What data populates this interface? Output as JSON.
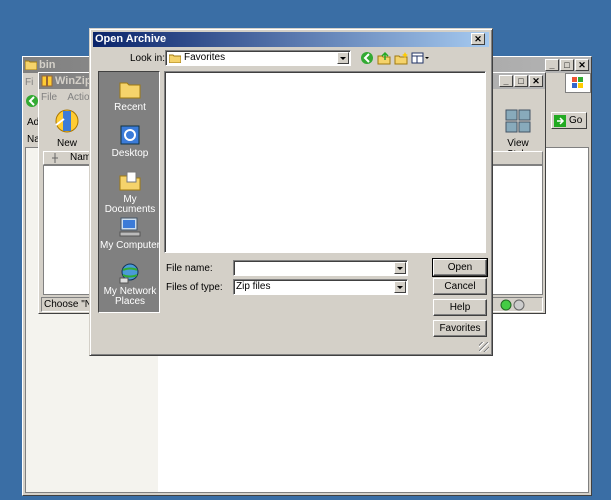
{
  "explorer": {
    "title": "bin",
    "menu_fragment": "Fi",
    "address_fragment": "Ad",
    "name_fragment": "Na",
    "go_label": "Go"
  },
  "winzip": {
    "title": "WinZip P",
    "menu": [
      "File",
      "Actions"
    ],
    "toolbar": {
      "new_label": "New",
      "view_style_label": "View Style"
    },
    "columns": {
      "name": "Name"
    },
    "status": "Choose \"New\""
  },
  "dialog": {
    "title": "Open Archive",
    "look_in_label": "Look in:",
    "look_in_value": "Favorites",
    "places": [
      {
        "label": "Recent",
        "icon": "recent-folder-icon"
      },
      {
        "label": "Desktop",
        "icon": "desktop-icon"
      },
      {
        "label": "My Documents",
        "icon": "my-documents-icon"
      },
      {
        "label": "My Computer",
        "icon": "my-computer-icon"
      },
      {
        "label": "My Network Places",
        "icon": "my-network-places-icon"
      }
    ],
    "file_name_label": "File name:",
    "file_name_value": "",
    "files_of_type_label": "Files of type:",
    "files_of_type_value": "Zip files",
    "buttons": {
      "open": "Open",
      "cancel": "Cancel",
      "help": "Help",
      "favorites": "Favorites"
    }
  },
  "colors": {
    "desktop": "#3a6ea5",
    "active_title": "#0a246a",
    "face": "#d4d0c8"
  }
}
